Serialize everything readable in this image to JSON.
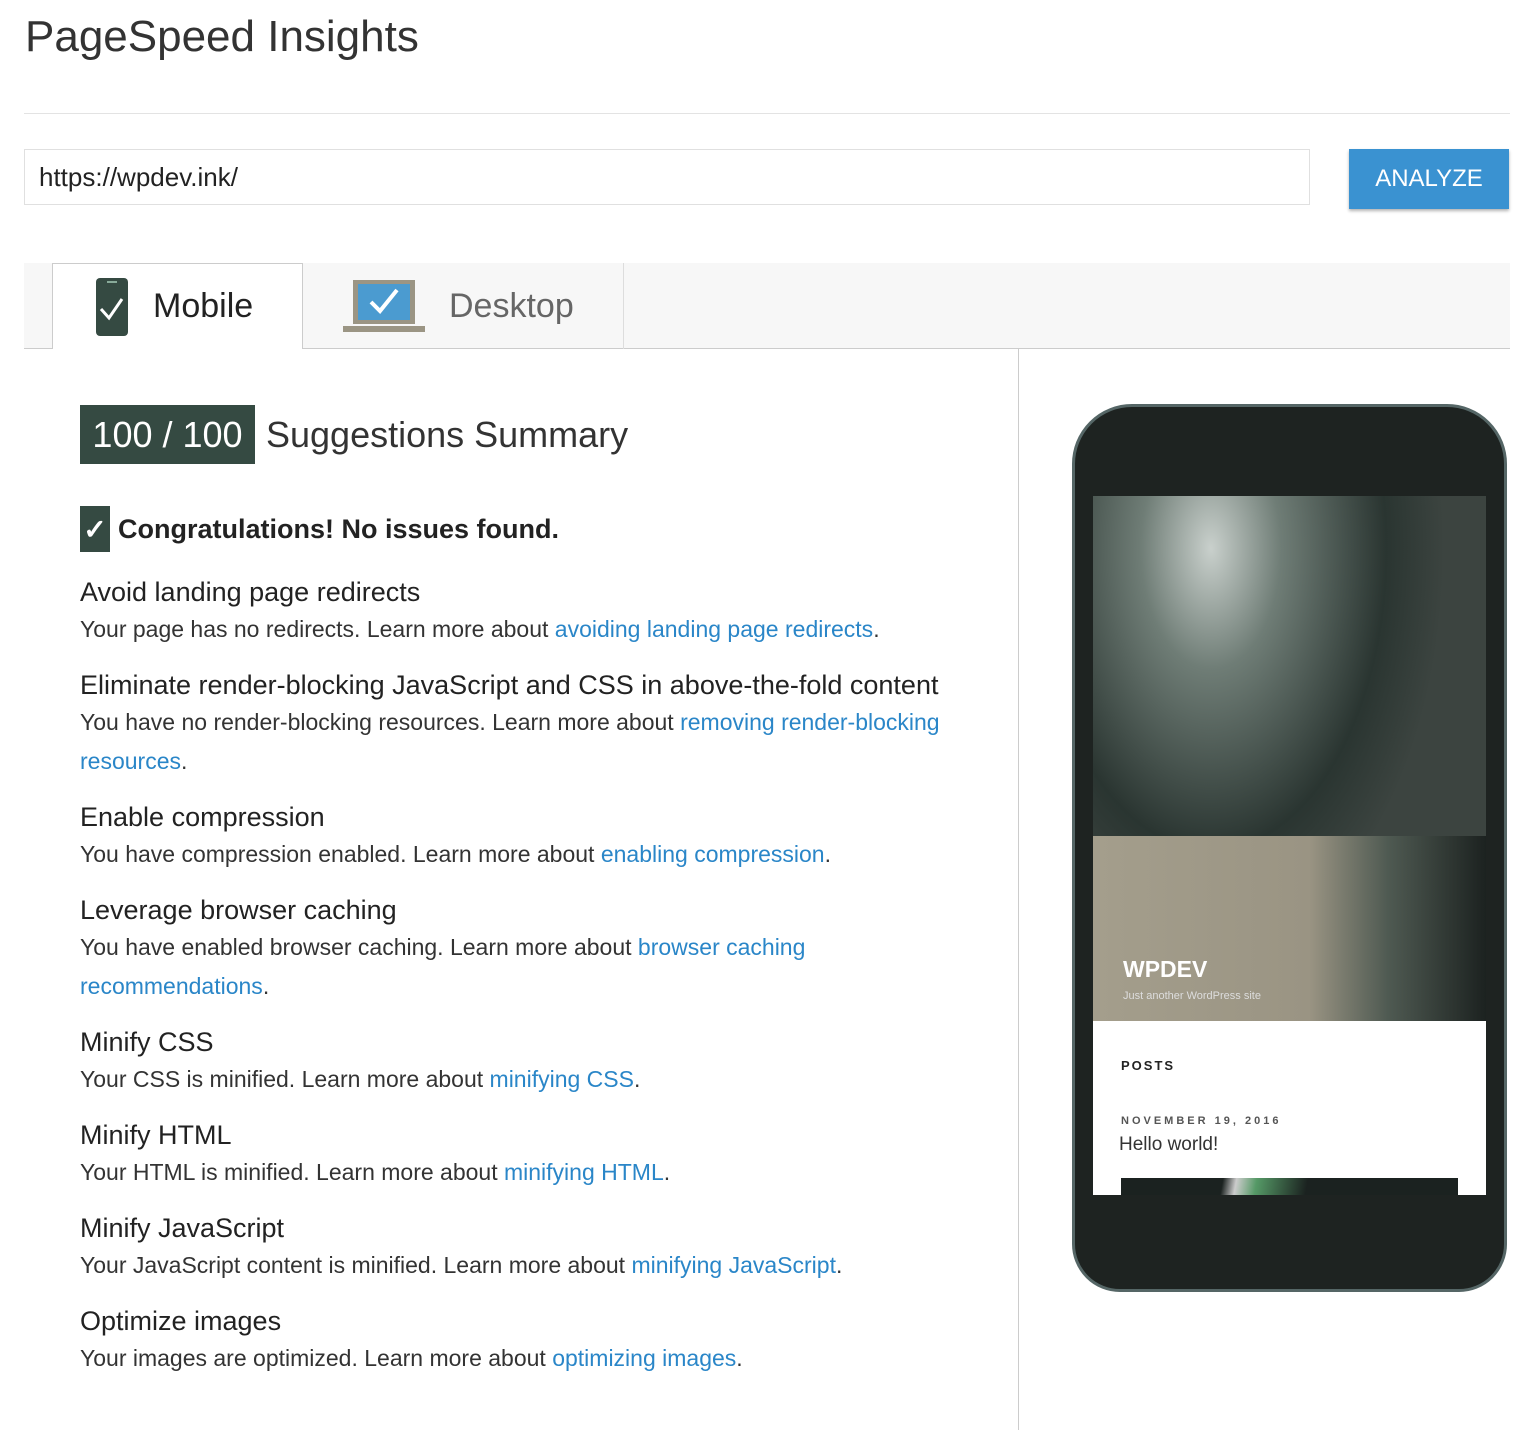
{
  "header": {
    "title": "PageSpeed Insights"
  },
  "search": {
    "url": "https://wpdev.ink/",
    "analyze_label": "ANALYZE"
  },
  "tabs": [
    {
      "label": "Mobile",
      "icon": "mobile-check-icon",
      "active": true
    },
    {
      "label": "Desktop",
      "icon": "desktop-check-icon",
      "active": false
    }
  ],
  "summary": {
    "score": "100 / 100",
    "title": "Suggestions Summary",
    "congrats": "Congratulations! No issues found."
  },
  "rules": [
    {
      "title": "Avoid landing page redirects",
      "text": "Your page has no redirects. Learn more about ",
      "link": "avoiding landing page redirects"
    },
    {
      "title": "Eliminate render-blocking JavaScript and CSS in above-the-fold content",
      "text": "You have no render-blocking resources. Learn more about ",
      "link": "removing render-blocking resources"
    },
    {
      "title": "Enable compression",
      "text": "You have compression enabled. Learn more about ",
      "link": "enabling compression"
    },
    {
      "title": "Leverage browser caching",
      "text": "You have enabled browser caching. Learn more about ",
      "link": "browser caching recommendations"
    },
    {
      "title": "Minify CSS",
      "text": "Your CSS is minified. Learn more about ",
      "link": "minifying CSS"
    },
    {
      "title": "Minify HTML",
      "text": "Your HTML is minified. Learn more about ",
      "link": "minifying HTML"
    },
    {
      "title": "Minify JavaScript",
      "text": "Your JavaScript content is minified. Learn more about ",
      "link": "minifying JavaScript"
    },
    {
      "title": "Optimize images",
      "text": "Your images are optimized. Learn more about ",
      "link": "optimizing images"
    }
  ],
  "preview": {
    "site_title": "WPDEV",
    "tagline": "Just another WordPress site",
    "posts_label": "POSTS",
    "post_date": "NOVEMBER 19, 2016",
    "post_title": "Hello world!"
  },
  "colors": {
    "accent": "#3a92d1",
    "score_bg": "#354a42",
    "link": "#2a86c8"
  }
}
